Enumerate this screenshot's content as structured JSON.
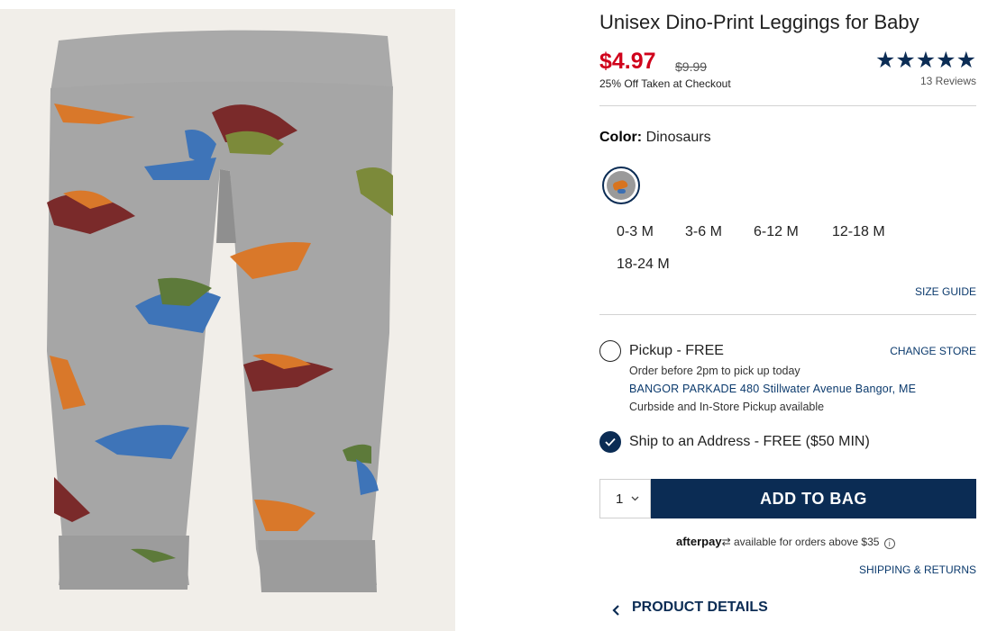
{
  "product": {
    "title": "Unisex Dino-Print Leggings for Baby",
    "price": "$4.97",
    "original_price": "$9.99",
    "discount_note": "25% Off Taken at Checkout",
    "rating_stars": "★★★★★",
    "reviews": "13 Reviews",
    "image_icon": "product-photo-dino-leggings"
  },
  "color": {
    "label": "Color:",
    "value": "Dinosaurs"
  },
  "sizes": [
    "0-3 M",
    "3-6 M",
    "6-12 M",
    "12-18 M",
    "18-24 M"
  ],
  "size_guide": "SIZE GUIDE",
  "fulfillment": {
    "pickup_label": "Pickup - FREE",
    "change_store": "CHANGE STORE",
    "pickup_note": "Order before 2pm to pick up today",
    "store_address": "BANGOR PARKADE 480 Stillwater Avenue  Bangor, ME",
    "curbside_note": "Curbside and In-Store Pickup available",
    "ship_label": "Ship to an Address - FREE ($50 MIN)",
    "selected": "ship"
  },
  "cart": {
    "quantity": "1",
    "add_to_bag": "ADD TO BAG"
  },
  "afterpay": {
    "logo": "afterpay",
    "text": "available for orders above $35",
    "info_icon": "i"
  },
  "shipping_returns": "SHIPPING & RETURNS",
  "product_details": "PRODUCT DETAILS",
  "colors": {
    "sale_red": "#d0021b",
    "navy": "#0b2c54",
    "link_blue": "#0b3a6d"
  }
}
